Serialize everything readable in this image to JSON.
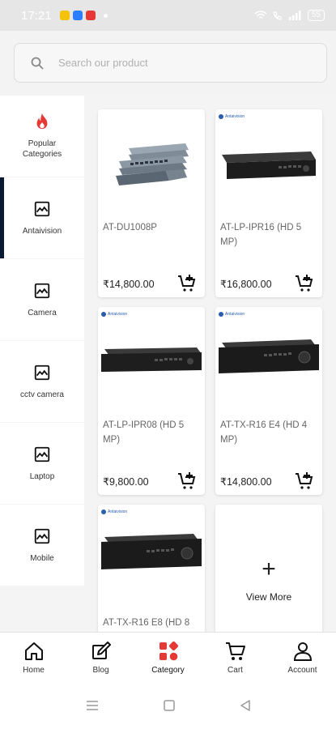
{
  "status_bar": {
    "time": "17:21",
    "battery": "55"
  },
  "search": {
    "placeholder": "Search our product"
  },
  "sidebar": {
    "items": [
      {
        "label": "Popular Categories",
        "icon": "flame-icon"
      },
      {
        "label": "Antaivision",
        "icon": "image-icon",
        "active": true
      },
      {
        "label": "Camera",
        "icon": "image-icon"
      },
      {
        "label": "cctv camera",
        "icon": "image-icon"
      },
      {
        "label": "Laptop",
        "icon": "image-icon"
      },
      {
        "label": "Mobile",
        "icon": "image-icon"
      }
    ]
  },
  "products": [
    {
      "name": "AT-DU1008P",
      "price": "₹14,800.00"
    },
    {
      "name": "AT-LP-IPR16 (HD 5 MP)",
      "price": "₹16,800.00"
    },
    {
      "name": "AT-LP-IPR08 (HD 5 MP)",
      "price": "₹9,800.00"
    },
    {
      "name": "AT-TX-R16 E4 (HD 4 MP)",
      "price": "₹14,800.00"
    },
    {
      "name": "AT-TX-R16 E8 (HD 8",
      "price": ""
    }
  ],
  "view_more": {
    "label": "View More"
  },
  "bottom_nav": {
    "items": [
      {
        "label": "Home",
        "icon": "home-icon"
      },
      {
        "label": "Blog",
        "icon": "blog-icon"
      },
      {
        "label": "Category",
        "icon": "category-icon",
        "active": true
      },
      {
        "label": "Cart",
        "icon": "cart-icon"
      },
      {
        "label": "Account",
        "icon": "account-icon"
      }
    ]
  },
  "colors": {
    "accent": "#e53935",
    "active_bar": "#0b1a33",
    "status_bar": "#e6e6e6"
  }
}
